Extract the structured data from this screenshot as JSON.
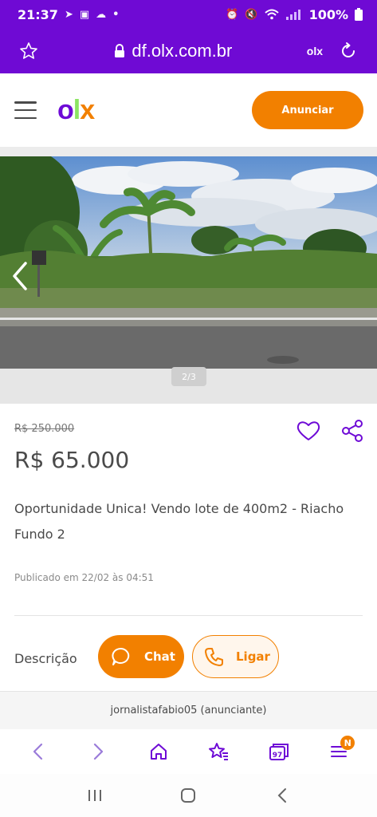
{
  "status_bar": {
    "time": "21:37",
    "battery": "100%"
  },
  "browser": {
    "url": "df.olx.com.br",
    "site_badge": "olx"
  },
  "header": {
    "logo": {
      "o": "o",
      "l": "l",
      "x": "x"
    },
    "cta_label": "Anunciar"
  },
  "gallery": {
    "counter": "2/3"
  },
  "ad": {
    "old_price": "R$ 250.000",
    "price": "R$ 65.000",
    "title": "Oportunidade Unica! Vendo lote de 400m2 - Riacho Fundo 2",
    "published": "Publicado em 22/02 às 04:51",
    "description_label": "Descrição"
  },
  "actions": {
    "chat_label": "Chat",
    "call_label": "Ligar"
  },
  "seller": {
    "name": "jornalistafabio05",
    "role": "(anunciante)"
  },
  "bottom_nav": {
    "tabs_count": "97",
    "menu_badge": "N"
  },
  "colors": {
    "brand_purple": "#6f0ad4",
    "brand_orange": "#f28000",
    "brand_green": "#8ce563"
  }
}
